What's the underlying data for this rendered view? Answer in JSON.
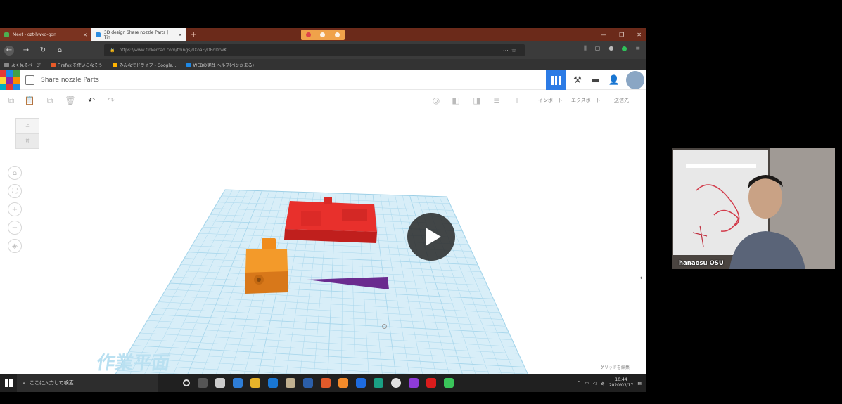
{
  "browser": {
    "tabs": [
      {
        "label": "Meet - ozt-hwxd-gqn",
        "active": false
      },
      {
        "label": "3D design Share nozzle Parts | Tin",
        "active": true
      }
    ],
    "url": "https://www.tinkercad.com/things/dXoaFyDEqDrwK",
    "bookmarks": [
      "よく見るページ",
      "Firefox を使いこなそう",
      "みんなでドライブ - Google...",
      "WEBの実践 ヘルプ(ペンかまる)"
    ]
  },
  "tinkercad": {
    "design_title": "Share nozzle Parts",
    "toolbar": {
      "import_label": "インポート",
      "export_label": "エクスポート",
      "send_label": "送信先"
    },
    "workplane_label": "作業平面",
    "snap_grid_label": "グリッドを編集"
  },
  "taskbar": {
    "search_placeholder": "ここに入力して検索",
    "time": "10:44",
    "date": "2020/03/17"
  },
  "webcam": {
    "participant_name": "hanaosu OSU"
  }
}
